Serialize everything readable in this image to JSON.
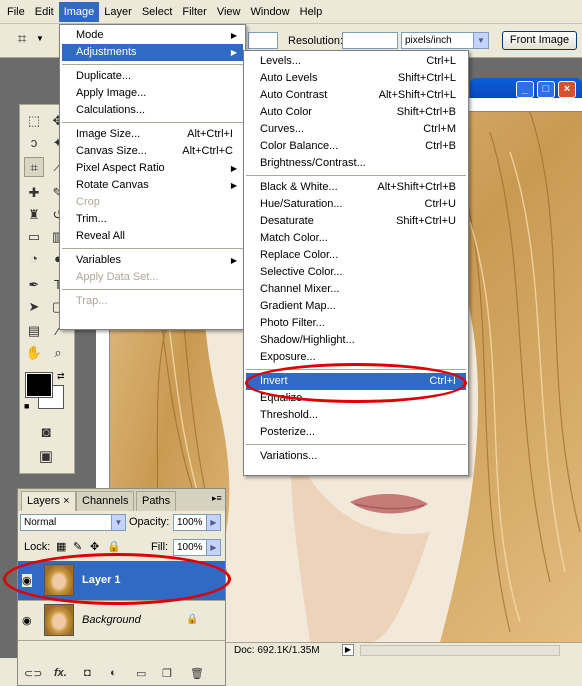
{
  "menubar": [
    "File",
    "Edit",
    "Image",
    "Layer",
    "Select",
    "Filter",
    "View",
    "Window",
    "Help"
  ],
  "options_bar": {
    "resolution_label": "Resolution:",
    "units_value": "pixels/inch",
    "front_image_label": "Front Image"
  },
  "image_menu": [
    {
      "label": "Mode",
      "submenu": true
    },
    {
      "label": "Adjustments",
      "submenu": true,
      "highlight": true
    },
    {
      "separator": true
    },
    {
      "label": "Duplicate..."
    },
    {
      "label": "Apply Image..."
    },
    {
      "label": "Calculations..."
    },
    {
      "separator": true
    },
    {
      "label": "Image Size...",
      "shortcut": "Alt+Ctrl+I"
    },
    {
      "label": "Canvas Size...",
      "shortcut": "Alt+Ctrl+C"
    },
    {
      "label": "Pixel Aspect Ratio",
      "submenu": true
    },
    {
      "label": "Rotate Canvas",
      "submenu": true
    },
    {
      "label": "Crop",
      "disabled": true
    },
    {
      "label": "Trim..."
    },
    {
      "label": "Reveal All"
    },
    {
      "separator": true
    },
    {
      "label": "Variables",
      "submenu": true
    },
    {
      "label": "Apply Data Set...",
      "disabled": true
    },
    {
      "separator": true
    },
    {
      "label": "Trap...",
      "disabled": true
    }
  ],
  "adjustments_menu": [
    {
      "label": "Levels...",
      "shortcut": "Ctrl+L"
    },
    {
      "label": "Auto Levels",
      "shortcut": "Shift+Ctrl+L"
    },
    {
      "label": "Auto Contrast",
      "shortcut": "Alt+Shift+Ctrl+L"
    },
    {
      "label": "Auto Color",
      "shortcut": "Shift+Ctrl+B"
    },
    {
      "label": "Curves...",
      "shortcut": "Ctrl+M"
    },
    {
      "label": "Color Balance...",
      "shortcut": "Ctrl+B"
    },
    {
      "label": "Brightness/Contrast..."
    },
    {
      "separator": true
    },
    {
      "label": "Black & White...",
      "shortcut": "Alt+Shift+Ctrl+B"
    },
    {
      "label": "Hue/Saturation...",
      "shortcut": "Ctrl+U"
    },
    {
      "label": "Desaturate",
      "shortcut": "Shift+Ctrl+U"
    },
    {
      "label": "Match Color..."
    },
    {
      "label": "Replace Color..."
    },
    {
      "label": "Selective Color..."
    },
    {
      "label": "Channel Mixer..."
    },
    {
      "label": "Gradient Map..."
    },
    {
      "label": "Photo Filter..."
    },
    {
      "label": "Shadow/Highlight..."
    },
    {
      "label": "Exposure..."
    },
    {
      "separator": true
    },
    {
      "label": "Invert",
      "shortcut": "Ctrl+I",
      "highlight": true
    },
    {
      "label": "Equalize"
    },
    {
      "label": "Threshold..."
    },
    {
      "label": "Posterize..."
    },
    {
      "separator": true
    },
    {
      "label": "Variations..."
    }
  ],
  "layers_panel": {
    "tabs": [
      "Layers",
      "Channels",
      "Paths"
    ],
    "tab_close": "×",
    "blend_mode": "Normal",
    "opacity_label": "Opacity:",
    "opacity_value": "100%",
    "lock_label": "Lock:",
    "fill_label": "Fill:",
    "fill_value": "100%",
    "layers": [
      {
        "name": "Layer 1",
        "selected": true
      },
      {
        "name": "Background",
        "locked": true
      }
    ],
    "footer_fx": "fx."
  },
  "status": {
    "doc_size": "Doc: 692.1K/1.35M"
  },
  "colors": {
    "menu_highlight": "#316ac5",
    "annotation": "#e00000",
    "chrome": "#ece9d8"
  }
}
